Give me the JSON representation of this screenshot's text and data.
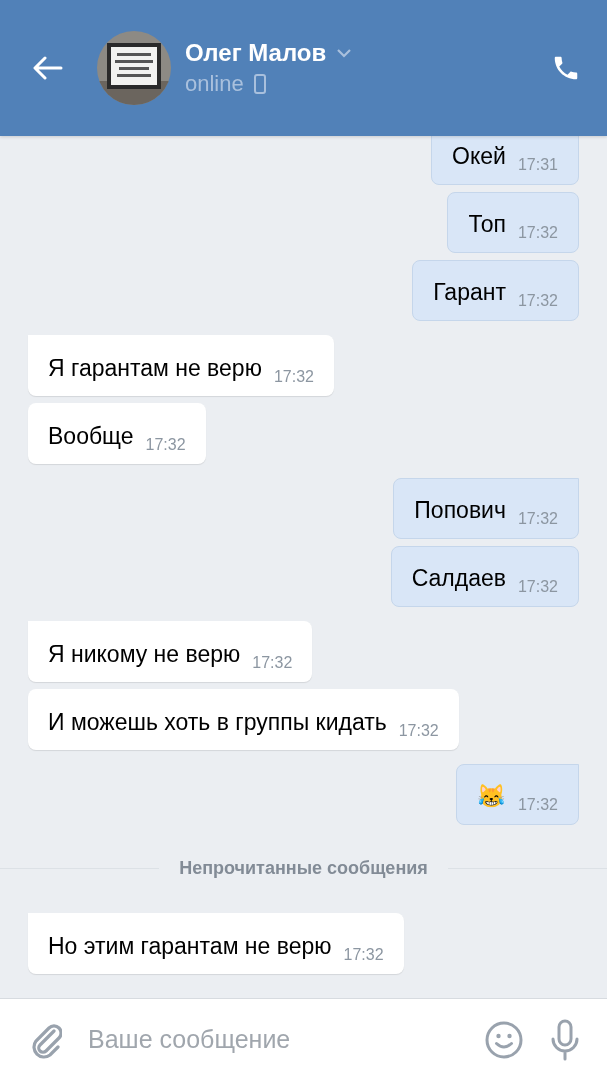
{
  "header": {
    "name": "Олег Малов",
    "status": "online"
  },
  "messages": [
    {
      "kind": "message",
      "outgoing": true,
      "text": "Окей",
      "time": "17:31",
      "tail": false
    },
    {
      "kind": "message",
      "outgoing": true,
      "text": "Топ",
      "time": "17:32",
      "tail": false
    },
    {
      "kind": "message",
      "outgoing": true,
      "text": "Гарант",
      "time": "17:32",
      "tail": false
    },
    {
      "kind": "message",
      "outgoing": false,
      "text": "Я гарантам не верю",
      "time": "17:32",
      "tail": true
    },
    {
      "kind": "message",
      "outgoing": false,
      "text": "Вообще",
      "time": "17:32",
      "tail": false
    },
    {
      "kind": "message",
      "outgoing": true,
      "text": "Попович",
      "time": "17:32",
      "tail": true
    },
    {
      "kind": "message",
      "outgoing": true,
      "text": "Салдаев",
      "time": "17:32",
      "tail": false
    },
    {
      "kind": "message",
      "outgoing": false,
      "text": "Я никому не верю",
      "time": "17:32",
      "tail": true
    },
    {
      "kind": "message",
      "outgoing": false,
      "text": "И можешь хоть в группы кидать",
      "time": "17:32",
      "tail": false
    },
    {
      "kind": "message",
      "outgoing": true,
      "text": "😹",
      "time": "17:32",
      "tail": true
    },
    {
      "kind": "divider",
      "text": "Непрочитанные сообщения"
    },
    {
      "kind": "message",
      "outgoing": false,
      "text": "Но этим гарантам не верю",
      "time": "17:32",
      "tail": true
    }
  ],
  "composer": {
    "placeholder": "Ваше сообщение"
  }
}
